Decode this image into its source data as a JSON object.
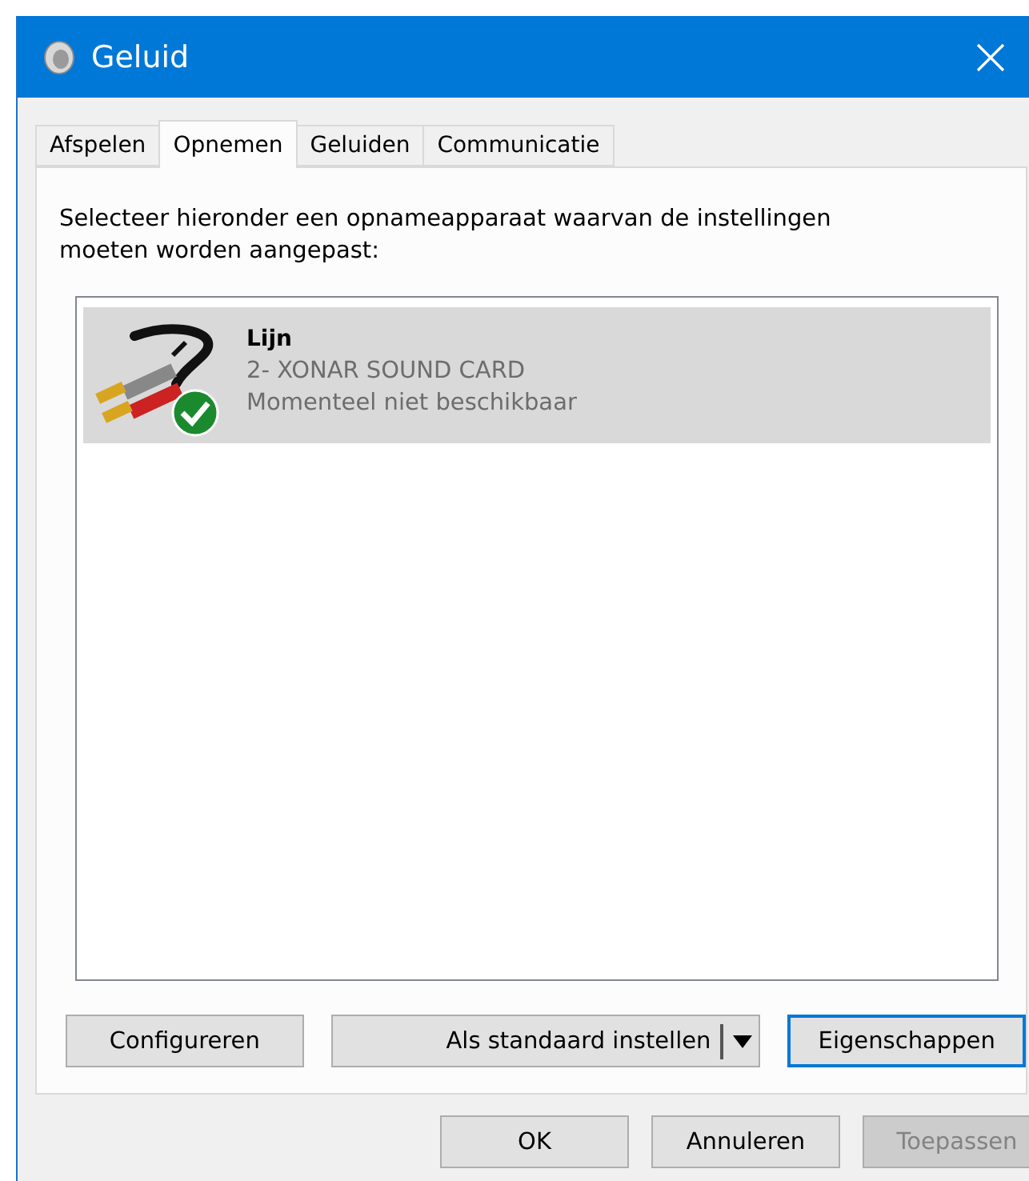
{
  "window": {
    "title": "Geluid"
  },
  "tabs": [
    {
      "label": "Afspelen",
      "selected": false
    },
    {
      "label": "Opnemen",
      "selected": true
    },
    {
      "label": "Geluiden",
      "selected": false
    },
    {
      "label": "Communicatie",
      "selected": false
    }
  ],
  "instruction": "Selecteer hieronder een opnameapparaat waarvan de instellingen moeten worden aangepast:",
  "devices": [
    {
      "name": "Lijn",
      "driver": "2- XONAR SOUND CARD",
      "status": "Momenteel niet beschikbaar",
      "selected": true,
      "default": true
    }
  ],
  "device_buttons": [
    {
      "label": "Configureren",
      "kind": "plain",
      "focused": false
    },
    {
      "label": "Als standaard instellen",
      "kind": "split",
      "focused": false
    },
    {
      "label": "Eigenschappen",
      "kind": "plain",
      "focused": true
    }
  ],
  "dialog_buttons": [
    {
      "label": "OK",
      "disabled": false
    },
    {
      "label": "Annuleren",
      "disabled": false
    },
    {
      "label": "Toepassen",
      "disabled": true
    }
  ]
}
